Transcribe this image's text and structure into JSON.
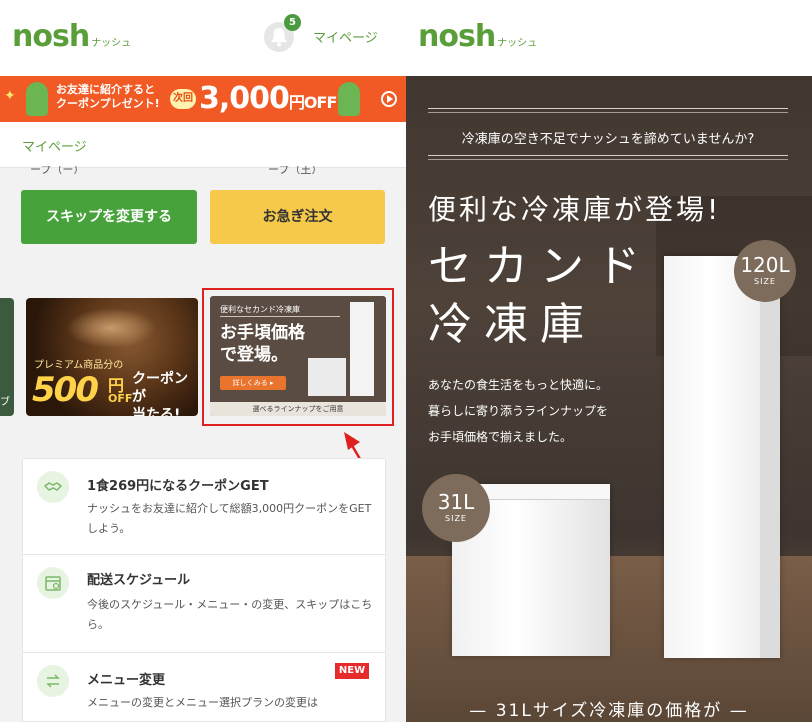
{
  "left": {
    "header": {
      "logo": "nosh",
      "logo_sub": "ナッシュ",
      "notification_count": "5",
      "mypage_link": "マイページ"
    },
    "banner": {
      "line1": "お友達に紹介すると",
      "line2": "クーポンプレゼント!",
      "next_label": "次回",
      "amount": "3,000",
      "amount_unit": "円OFF",
      "bg_color": "#f15a24"
    },
    "breadcrumb": "マイページ",
    "cut_text_1": "ープ（ー）",
    "cut_text_2": "ープ（王）",
    "buttons": {
      "skip": "スキップを変更する",
      "rush": "お急ぎ注文"
    },
    "promo_burger": {
      "pre": "プレミアム商品分の",
      "amount": "500",
      "yen": "円",
      "off": "OFF",
      "coupon_line1": "クーポンが",
      "coupon_line2": "当たる!"
    },
    "promo_freezer": {
      "top": "便利なセカンド冷凍庫",
      "main_line1": "お手頃価格",
      "main_line2": "で登場。",
      "button": "詳しくみる ▸",
      "bottom": "選べるラインナップをご用意"
    },
    "menu": [
      {
        "icon": "handshake-icon",
        "title": "1食269円になるクーポンGET",
        "desc": "ナッシュをお友達に紹介して総額3,000円クーポンをGETしよう。"
      },
      {
        "icon": "calendar-icon",
        "title": "配送スケジュール",
        "desc": "今後のスケジュール・メニュー・の変更、スキップはこちら。"
      },
      {
        "icon": "swap-icon",
        "title": "メニュー変更",
        "badge": "NEW",
        "desc": "メニューの変更とメニュー選択プランの変更は"
      }
    ]
  },
  "right": {
    "header": {
      "logo": "nosh",
      "logo_sub": "ナッシュ"
    },
    "question": "冷凍庫の空き不足でナッシュを諦めていませんか?",
    "headline1": "便利な冷凍庫が登場!",
    "headline2": "セカンド",
    "headline3": "冷凍庫",
    "body_line1": "あなたの食生活をもっと快適に。",
    "body_line2": "暮らしに寄り添うラインナップを",
    "body_line3": "お手頃価格で揃えました。",
    "size_large": "120L",
    "size_small": "31L",
    "size_label": "SIZE",
    "bottom_text": "— 31Lサイズ冷凍庫の価格が —"
  }
}
